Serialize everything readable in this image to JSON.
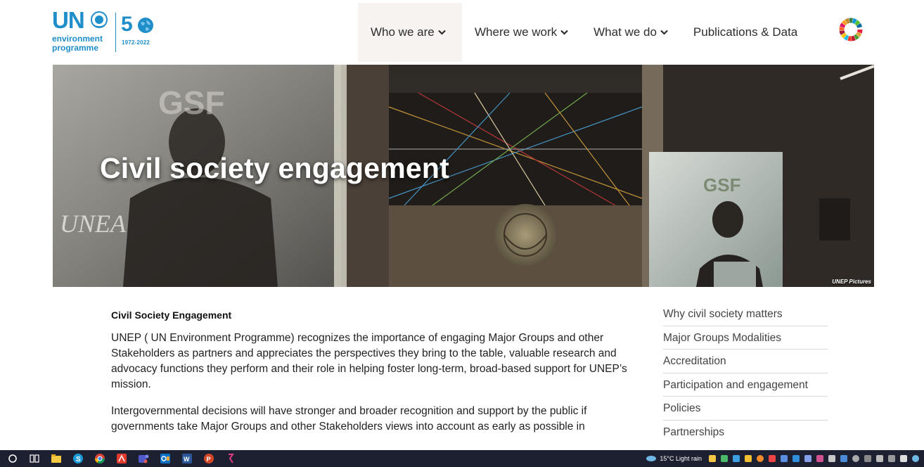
{
  "logo": {
    "org_short": "UN",
    "org_line1": "environment",
    "org_line2": "programme",
    "anniversary_number": "5",
    "anniversary_years": "1972-2022"
  },
  "nav": {
    "items": [
      {
        "label": "Who we are",
        "has_dropdown": true,
        "active": true
      },
      {
        "label": "Where we work",
        "has_dropdown": true
      },
      {
        "label": "What we do",
        "has_dropdown": true
      },
      {
        "label": "Publications & Data",
        "has_dropdown": false
      }
    ],
    "sdg_icon": "sdg-wheel-icon"
  },
  "hero": {
    "title": "Civil society engagement",
    "credit": "UNEP Pictures",
    "screen_text": "GSF",
    "podium_text": "UNEA"
  },
  "content": {
    "heading": "Civil Society Engagement",
    "paragraphs": [
      "UNEP ( UN Environment Programme) recognizes the importance of engaging Major Groups and other Stakeholders as partners and appreciates the perspectives they bring to the table, valuable research and advocacy functions they perform and their role in helping foster long-term, broad-based support for UNEP’s mission.",
      "Intergovernmental decisions will have stronger and broader recognition and support by the public if governments take Major Groups and other Stakeholders views into account as early as possible in"
    ]
  },
  "sidebar": {
    "items": [
      "Why civil society matters",
      "Major Groups Modalities",
      "Accreditation",
      "Participation and engagement",
      "Policies",
      "Partnerships"
    ]
  },
  "taskbar": {
    "weather": "15°C  Light rain",
    "apps": [
      "start-icon",
      "task-view-icon",
      "file-explorer-icon",
      "skype-icon",
      "chrome-icon",
      "acrobat-icon",
      "teams-icon",
      "outlook-icon",
      "word-icon",
      "powerpoint-icon",
      "zoom-icon"
    ],
    "colors": {
      "bar": "#1d2030"
    }
  },
  "colors": {
    "brand_blue": "#1f8ec9",
    "nav_active_bg": "#f7f3f1",
    "text": "#222222"
  }
}
